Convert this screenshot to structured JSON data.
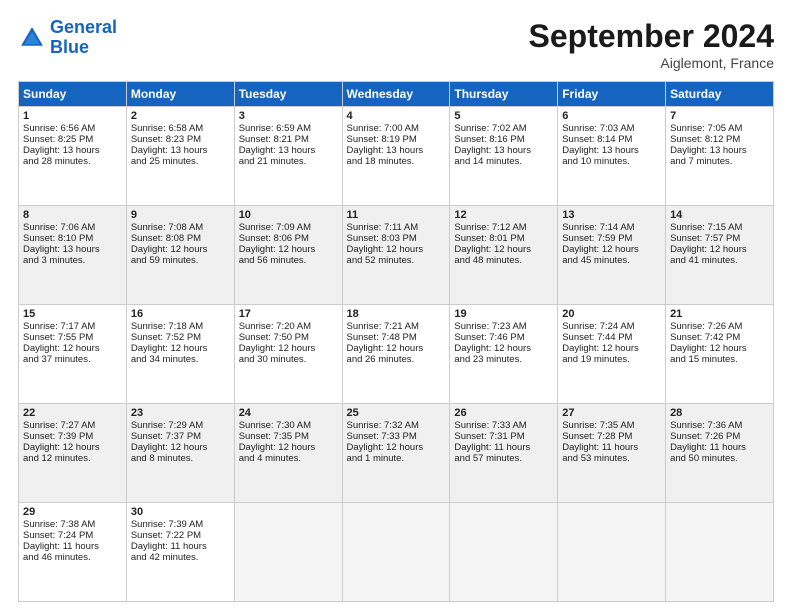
{
  "logo": {
    "line1": "General",
    "line2": "Blue"
  },
  "title": "September 2024",
  "subtitle": "Aiglemont, France",
  "days_header": [
    "Sunday",
    "Monday",
    "Tuesday",
    "Wednesday",
    "Thursday",
    "Friday",
    "Saturday"
  ],
  "weeks": [
    {
      "shaded": false,
      "days": [
        {
          "num": "1",
          "lines": [
            "Sunrise: 6:56 AM",
            "Sunset: 8:25 PM",
            "Daylight: 13 hours",
            "and 28 minutes."
          ]
        },
        {
          "num": "2",
          "lines": [
            "Sunrise: 6:58 AM",
            "Sunset: 8:23 PM",
            "Daylight: 13 hours",
            "and 25 minutes."
          ]
        },
        {
          "num": "3",
          "lines": [
            "Sunrise: 6:59 AM",
            "Sunset: 8:21 PM",
            "Daylight: 13 hours",
            "and 21 minutes."
          ]
        },
        {
          "num": "4",
          "lines": [
            "Sunrise: 7:00 AM",
            "Sunset: 8:19 PM",
            "Daylight: 13 hours",
            "and 18 minutes."
          ]
        },
        {
          "num": "5",
          "lines": [
            "Sunrise: 7:02 AM",
            "Sunset: 8:16 PM",
            "Daylight: 13 hours",
            "and 14 minutes."
          ]
        },
        {
          "num": "6",
          "lines": [
            "Sunrise: 7:03 AM",
            "Sunset: 8:14 PM",
            "Daylight: 13 hours",
            "and 10 minutes."
          ]
        },
        {
          "num": "7",
          "lines": [
            "Sunrise: 7:05 AM",
            "Sunset: 8:12 PM",
            "Daylight: 13 hours",
            "and 7 minutes."
          ]
        }
      ]
    },
    {
      "shaded": true,
      "days": [
        {
          "num": "8",
          "lines": [
            "Sunrise: 7:06 AM",
            "Sunset: 8:10 PM",
            "Daylight: 13 hours",
            "and 3 minutes."
          ]
        },
        {
          "num": "9",
          "lines": [
            "Sunrise: 7:08 AM",
            "Sunset: 8:08 PM",
            "Daylight: 12 hours",
            "and 59 minutes."
          ]
        },
        {
          "num": "10",
          "lines": [
            "Sunrise: 7:09 AM",
            "Sunset: 8:06 PM",
            "Daylight: 12 hours",
            "and 56 minutes."
          ]
        },
        {
          "num": "11",
          "lines": [
            "Sunrise: 7:11 AM",
            "Sunset: 8:03 PM",
            "Daylight: 12 hours",
            "and 52 minutes."
          ]
        },
        {
          "num": "12",
          "lines": [
            "Sunrise: 7:12 AM",
            "Sunset: 8:01 PM",
            "Daylight: 12 hours",
            "and 48 minutes."
          ]
        },
        {
          "num": "13",
          "lines": [
            "Sunrise: 7:14 AM",
            "Sunset: 7:59 PM",
            "Daylight: 12 hours",
            "and 45 minutes."
          ]
        },
        {
          "num": "14",
          "lines": [
            "Sunrise: 7:15 AM",
            "Sunset: 7:57 PM",
            "Daylight: 12 hours",
            "and 41 minutes."
          ]
        }
      ]
    },
    {
      "shaded": false,
      "days": [
        {
          "num": "15",
          "lines": [
            "Sunrise: 7:17 AM",
            "Sunset: 7:55 PM",
            "Daylight: 12 hours",
            "and 37 minutes."
          ]
        },
        {
          "num": "16",
          "lines": [
            "Sunrise: 7:18 AM",
            "Sunset: 7:52 PM",
            "Daylight: 12 hours",
            "and 34 minutes."
          ]
        },
        {
          "num": "17",
          "lines": [
            "Sunrise: 7:20 AM",
            "Sunset: 7:50 PM",
            "Daylight: 12 hours",
            "and 30 minutes."
          ]
        },
        {
          "num": "18",
          "lines": [
            "Sunrise: 7:21 AM",
            "Sunset: 7:48 PM",
            "Daylight: 12 hours",
            "and 26 minutes."
          ]
        },
        {
          "num": "19",
          "lines": [
            "Sunrise: 7:23 AM",
            "Sunset: 7:46 PM",
            "Daylight: 12 hours",
            "and 23 minutes."
          ]
        },
        {
          "num": "20",
          "lines": [
            "Sunrise: 7:24 AM",
            "Sunset: 7:44 PM",
            "Daylight: 12 hours",
            "and 19 minutes."
          ]
        },
        {
          "num": "21",
          "lines": [
            "Sunrise: 7:26 AM",
            "Sunset: 7:42 PM",
            "Daylight: 12 hours",
            "and 15 minutes."
          ]
        }
      ]
    },
    {
      "shaded": true,
      "days": [
        {
          "num": "22",
          "lines": [
            "Sunrise: 7:27 AM",
            "Sunset: 7:39 PM",
            "Daylight: 12 hours",
            "and 12 minutes."
          ]
        },
        {
          "num": "23",
          "lines": [
            "Sunrise: 7:29 AM",
            "Sunset: 7:37 PM",
            "Daylight: 12 hours",
            "and 8 minutes."
          ]
        },
        {
          "num": "24",
          "lines": [
            "Sunrise: 7:30 AM",
            "Sunset: 7:35 PM",
            "Daylight: 12 hours",
            "and 4 minutes."
          ]
        },
        {
          "num": "25",
          "lines": [
            "Sunrise: 7:32 AM",
            "Sunset: 7:33 PM",
            "Daylight: 12 hours",
            "and 1 minute."
          ]
        },
        {
          "num": "26",
          "lines": [
            "Sunrise: 7:33 AM",
            "Sunset: 7:31 PM",
            "Daylight: 11 hours",
            "and 57 minutes."
          ]
        },
        {
          "num": "27",
          "lines": [
            "Sunrise: 7:35 AM",
            "Sunset: 7:28 PM",
            "Daylight: 11 hours",
            "and 53 minutes."
          ]
        },
        {
          "num": "28",
          "lines": [
            "Sunrise: 7:36 AM",
            "Sunset: 7:26 PM",
            "Daylight: 11 hours",
            "and 50 minutes."
          ]
        }
      ]
    },
    {
      "shaded": false,
      "days": [
        {
          "num": "29",
          "lines": [
            "Sunrise: 7:38 AM",
            "Sunset: 7:24 PM",
            "Daylight: 11 hours",
            "and 46 minutes."
          ]
        },
        {
          "num": "30",
          "lines": [
            "Sunrise: 7:39 AM",
            "Sunset: 7:22 PM",
            "Daylight: 11 hours",
            "and 42 minutes."
          ]
        },
        null,
        null,
        null,
        null,
        null
      ]
    }
  ]
}
